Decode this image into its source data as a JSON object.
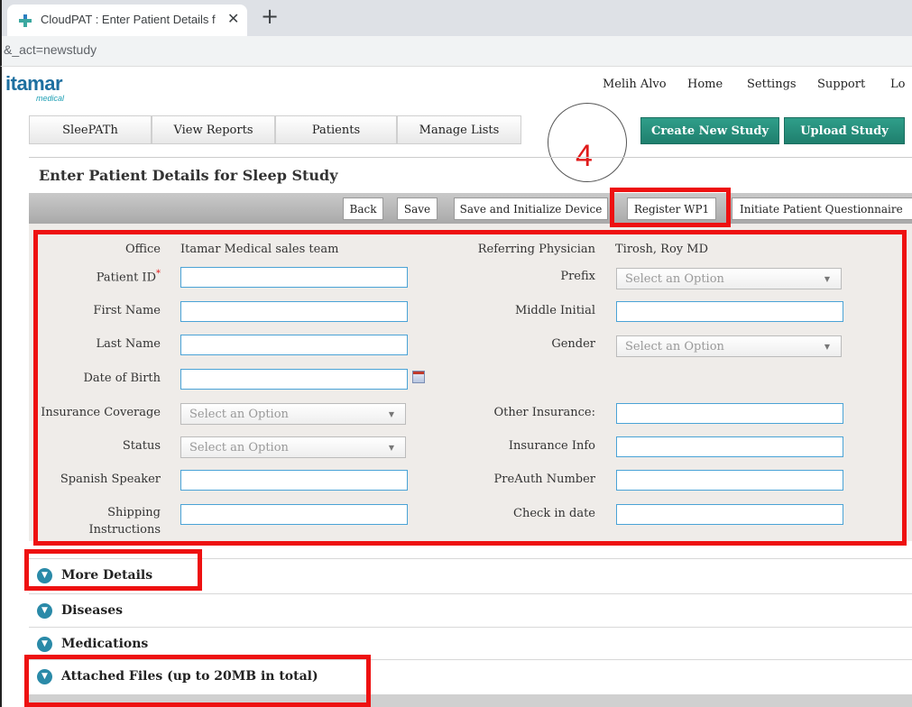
{
  "browser": {
    "tab_title": "CloudPAT : Enter Patient Details f",
    "tab_close": "✕",
    "new_tab": "+",
    "url": "&_act=newstudy"
  },
  "brand": {
    "logo_main": "itamar",
    "logo_sub": "medical"
  },
  "header": {
    "links": [
      "Melih Alvo",
      "Home",
      "Settings",
      "Support",
      "Lo"
    ]
  },
  "nav": {
    "tabs": [
      "SleePATh",
      "View Reports",
      "Patients",
      "Manage Lists"
    ],
    "create_study": "Create New Study",
    "upload_study": "Upload Study"
  },
  "annotation": {
    "step": "4"
  },
  "page_title": "Enter Patient Details for Sleep Study",
  "toolbar": {
    "back": "Back",
    "save": "Save",
    "save_init": "Save and Initialize Device",
    "register": "Register WP1",
    "questionnaire": "Initiate Patient Questionnaire"
  },
  "form": {
    "office_label": "Office",
    "office_value": "Itamar Medical sales team",
    "referring_label": "Referring Physician",
    "referring_value": "Tirosh, Roy MD",
    "patient_id_label": "Patient ID",
    "required_mark": "*",
    "prefix_label": "Prefix",
    "first_name_label": "First Name",
    "middle_initial_label": "Middle Initial",
    "last_name_label": "Last Name",
    "gender_label": "Gender",
    "dob_label": "Date of Birth",
    "insurance_coverage_label": "Insurance Coverage",
    "other_insurance_label": "Other Insurance:",
    "status_label": "Status",
    "insurance_info_label": "Insurance Info",
    "spanish_label": "Spanish Speaker",
    "preauth_label": "PreAuth Number",
    "shipping_label_1": "Shipping",
    "shipping_label_2": "Instructions",
    "checkin_label": "Check in date",
    "select_placeholder": "Select an Option",
    "select_arrow": "▼"
  },
  "sections": [
    "More Details",
    "Diseases",
    "Medications",
    "Attached Files (up to 20MB in total)"
  ],
  "colors": {
    "highlight": "#ee1111",
    "accent_green": "#1f7f6e",
    "input_border": "#4aa3d6"
  }
}
